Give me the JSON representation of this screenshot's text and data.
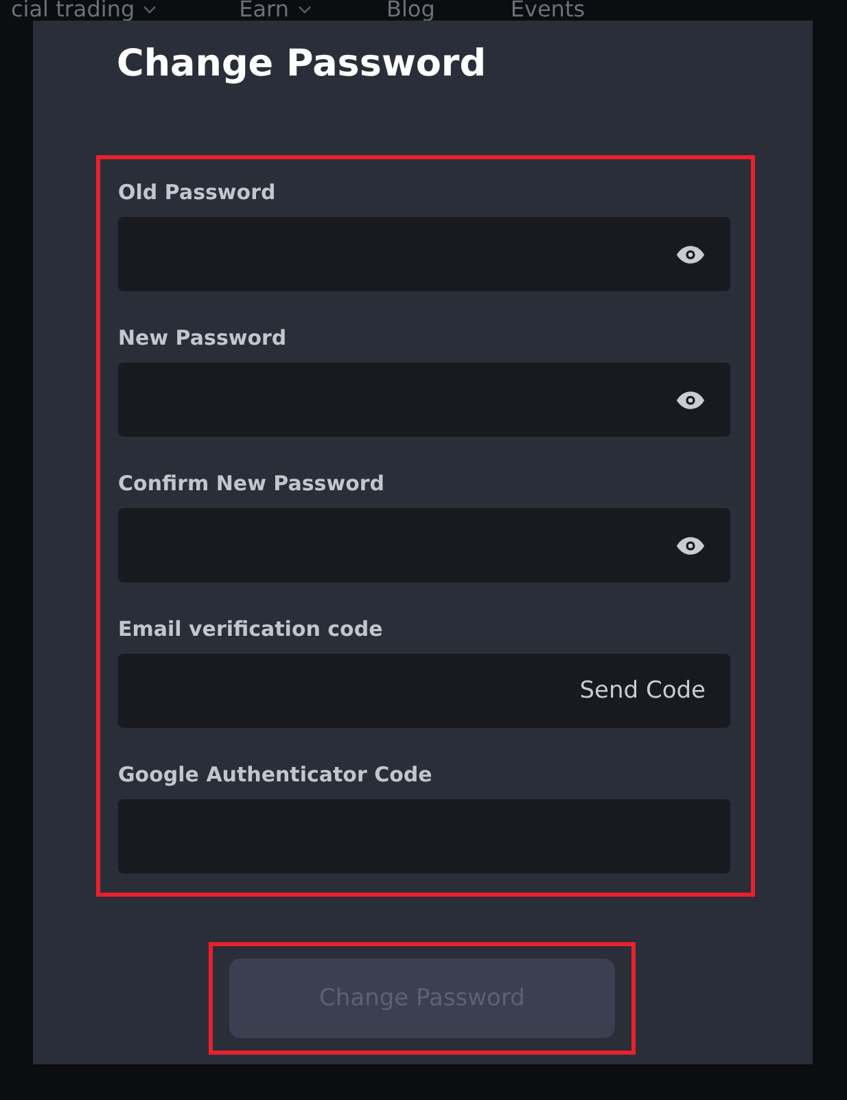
{
  "nav": [
    {
      "label": "cial trading",
      "dropdown": true
    },
    {
      "label": "Earn",
      "dropdown": true
    },
    {
      "label": "Blog",
      "dropdown": false
    },
    {
      "label": "Events",
      "dropdown": false
    }
  ],
  "dialog": {
    "title": "Change Password",
    "fields": [
      {
        "label": "Old Password",
        "kind": "password"
      },
      {
        "label": "New Password",
        "kind": "password"
      },
      {
        "label": "Confirm New Password",
        "kind": "password"
      },
      {
        "label": "Email verification code",
        "kind": "code",
        "action": "Send Code"
      },
      {
        "label": "Google Authenticator Code",
        "kind": "text"
      }
    ],
    "button": {
      "label": "Change Password",
      "disabled": true
    }
  }
}
